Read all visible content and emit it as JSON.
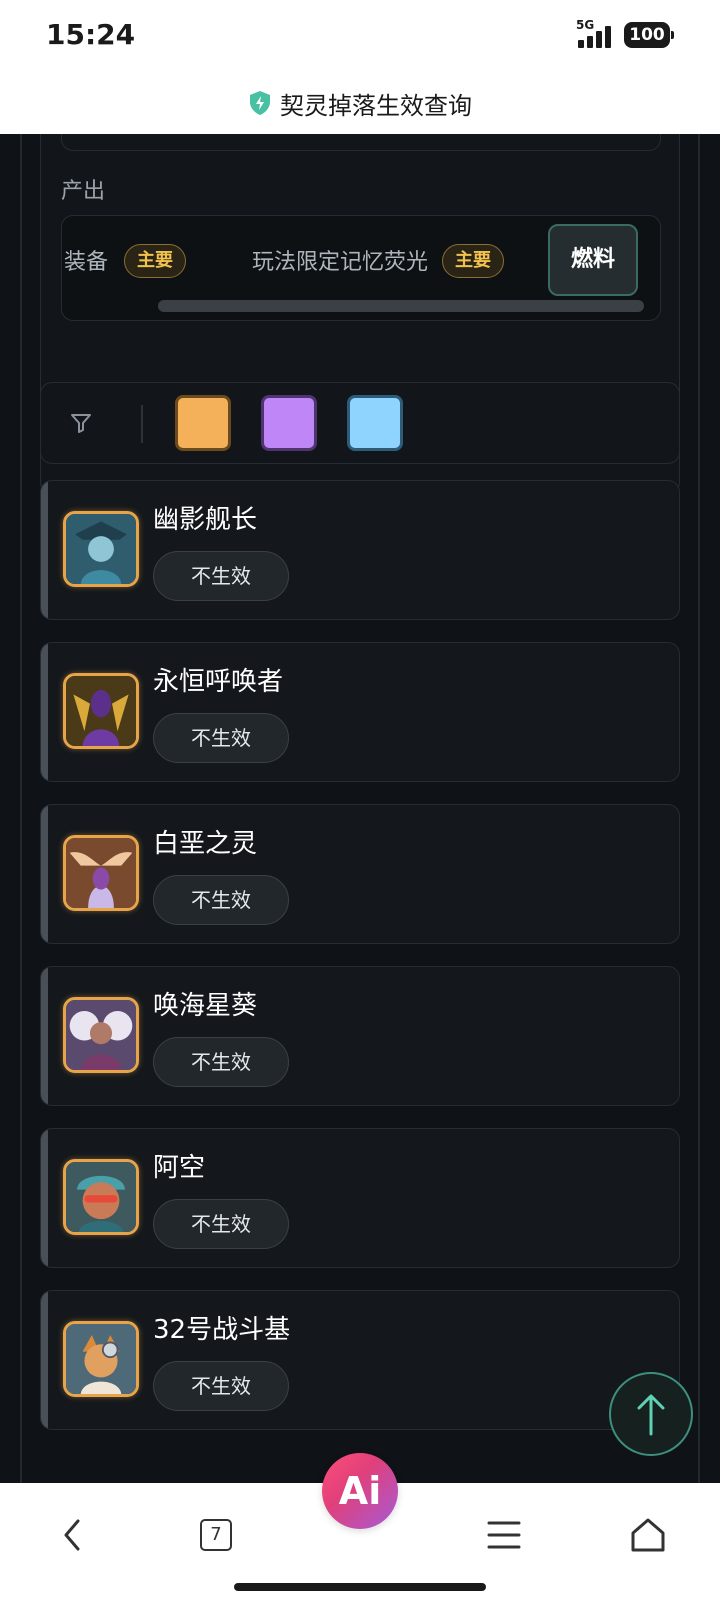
{
  "status_bar": {
    "time": "15:24",
    "network": "5G",
    "battery": "100"
  },
  "page": {
    "title": "契灵掉落生效查询"
  },
  "output": {
    "label": "产出",
    "items": [
      {
        "text": "专属装备",
        "badge": "主要"
      },
      {
        "text": "玩法限定记忆荧光",
        "badge": "主要"
      }
    ],
    "fuel_button": "燃料"
  },
  "filter": {
    "swatches": [
      "#f4b15a",
      "#bf86f8",
      "#8fd3ff"
    ]
  },
  "cards": [
    {
      "name": "幽影舰长",
      "status": "不生效"
    },
    {
      "name": "永恒呼唤者",
      "status": "不生效"
    },
    {
      "name": "白垩之灵",
      "status": "不生效"
    },
    {
      "name": "唤海星葵",
      "status": "不生效"
    },
    {
      "name": "阿空",
      "status": "不生效"
    },
    {
      "name": "32号战斗基",
      "status": "不生效"
    }
  ],
  "bottom_nav": {
    "tab_count": "7",
    "ai_label": "Ai"
  },
  "colors": {
    "accent_teal": "#3d8f80",
    "badge_gold": "#f2c24d",
    "avatar_border": "#e8a44a"
  }
}
